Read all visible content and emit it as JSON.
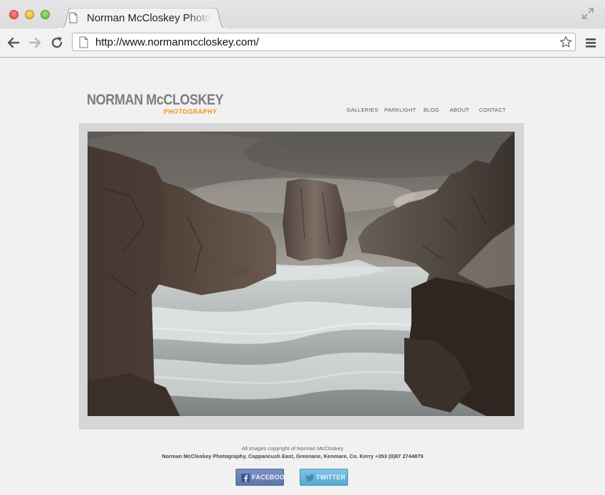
{
  "browser": {
    "tab_title": "Norman McCloskey Photography",
    "url": "http://www.normanmccloskey.com/"
  },
  "site": {
    "logo_name": "NORMAN McCLOSKEY",
    "logo_sub": "PHOTOGRAPHY",
    "nav": [
      "GALLERIES",
      "PARKLIGHT",
      "BLOG",
      "ABOUT",
      "CONTACT"
    ],
    "footer_copyright": "All images copyright of Norman McCloskey",
    "footer_address": "Norman McCloskey Photography, Cappancush East, Greenane, Kenmare, Co. Kerry +353 (0)87 2744879",
    "social": {
      "facebook": "FACEBOOK",
      "twitter": "TWITTER"
    }
  },
  "colors": {
    "logo_gray": "#7e7e7e",
    "logo_orange": "#f0941d",
    "facebook_blue": "#6a80b6",
    "twitter_blue": "#6bb5db"
  },
  "icons": [
    "back-arrow-icon",
    "forward-arrow-icon",
    "reload-icon",
    "page-icon",
    "star-icon",
    "menu-icon",
    "fullscreen-icon",
    "facebook-icon",
    "twitter-icon"
  ]
}
